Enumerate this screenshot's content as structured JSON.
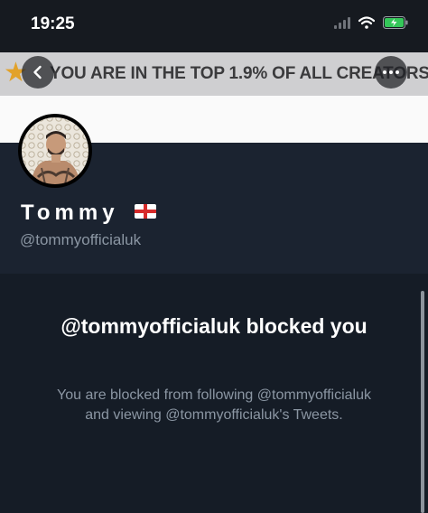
{
  "status_bar": {
    "time": "19:25"
  },
  "banner": {
    "text": "YOU ARE IN THE TOP 1.9% OF ALL CREATORS!",
    "icon": "star-icon"
  },
  "profile": {
    "name": "Tommy",
    "flag": "england-flag-icon",
    "handle": "@tommyofficialuk"
  },
  "blocked_notice": {
    "title": "@tommyofficialuk blocked you",
    "description": "You are blocked from following @tommyofficialuk and viewing @tommyofficialuk's Tweets."
  },
  "colors": {
    "background": "#151c26",
    "profile_bg": "#1b2330",
    "muted_text": "#8b96a3",
    "banner_bg": "#cfcfd1"
  }
}
